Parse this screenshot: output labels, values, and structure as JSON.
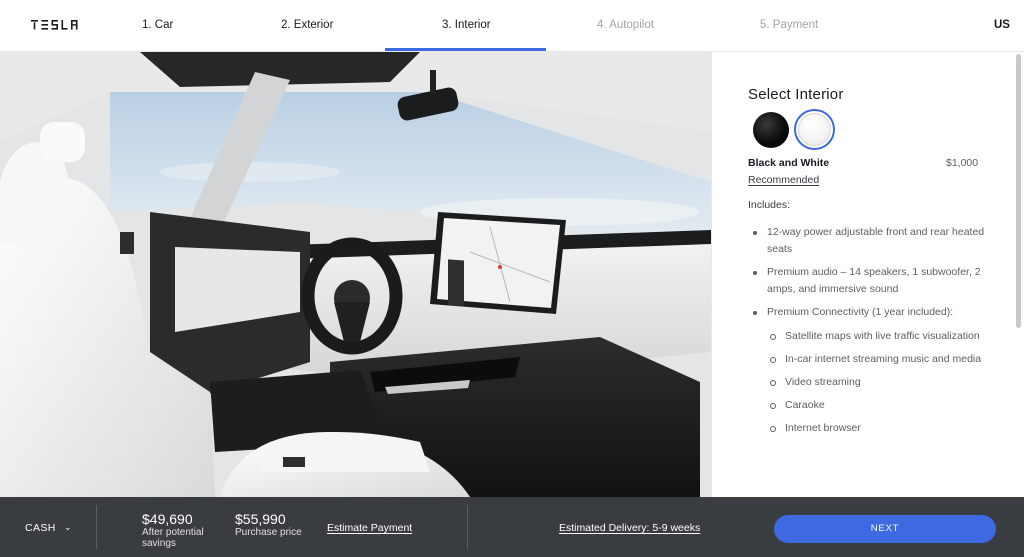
{
  "nav": {
    "brand": "TESLA",
    "steps": [
      {
        "label": "1. Car"
      },
      {
        "label": "2. Exterior"
      },
      {
        "label": "3. Interior"
      },
      {
        "label": "4. Autopilot"
      },
      {
        "label": "5. Payment"
      }
    ],
    "active_step": "3. Interior",
    "region": "US"
  },
  "panel": {
    "title": "Select Interior",
    "swatches": [
      {
        "name": "Black",
        "color": "#000000"
      },
      {
        "name": "Black and White",
        "color": "#ffffff",
        "selected": true
      }
    ],
    "selected_name": "Black and White",
    "selected_price": "$1,000",
    "recommended": "Recommended",
    "includes_label": "Includes:",
    "includes": [
      "12-way power adjustable front and rear heated seats",
      "Premium audio – 14 speakers, 1 subwoofer, 2 amps, and immersive sound",
      "Premium Connectivity (1 year included):"
    ],
    "connectivity": [
      "Satellite maps with live traffic visualization",
      "In-car internet streaming music and media",
      "Video streaming",
      "Caraoke",
      "Internet browser"
    ]
  },
  "footer": {
    "payment_type": "CASH",
    "savings_price": "$49,690",
    "savings_label_1": "After potential",
    "savings_label_2": "savings",
    "purchase_price": "$55,990",
    "purchase_label": "Purchase price",
    "estimate_link": "Estimate Payment",
    "delivery_link": "Estimated Delivery: 5-9 weeks",
    "next_label": "NEXT"
  },
  "colors": {
    "accent": "#3e6ae1",
    "footer_bg": "#393c41",
    "text": "#171a20",
    "muted": "#5c5e62"
  }
}
